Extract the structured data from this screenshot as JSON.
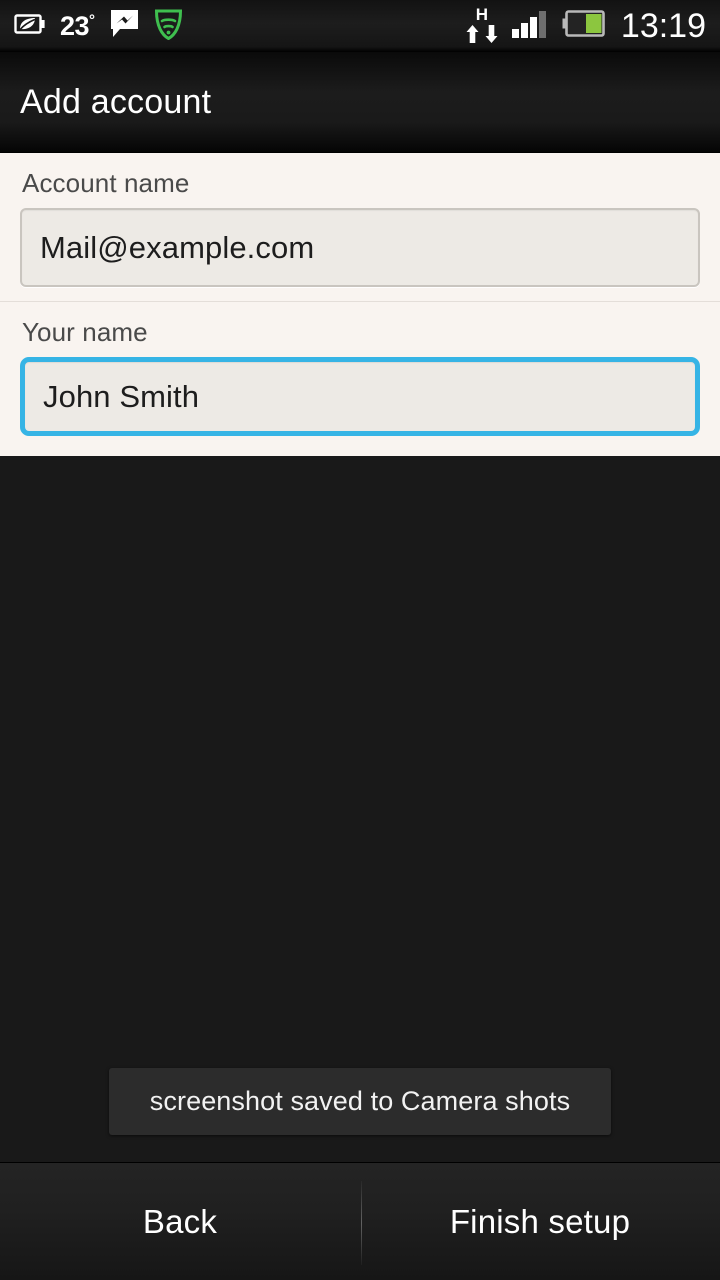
{
  "status_bar": {
    "temperature": "23",
    "temperature_unit": "°",
    "clock": "13:19",
    "network_type": "H",
    "icons": {
      "eco_battery": "eco-battery-icon",
      "messenger": "messenger-icon",
      "security_shield": "security-shield-icon",
      "data_arrows": "data-transfer-arrows-icon",
      "signal": "signal-bars-icon",
      "battery": "battery-icon"
    },
    "signal_bars_filled": 3,
    "signal_bars_total": 4,
    "battery_level_percent": 45,
    "colors": {
      "battery_fill": "#8cc63f",
      "shield": "#3fbf4f"
    }
  },
  "header": {
    "title": "Add account"
  },
  "form": {
    "fields": [
      {
        "label": "Account name",
        "value": "Mail@example.com",
        "focused": false
      },
      {
        "label": "Your name",
        "value": "John Smith",
        "focused": true
      }
    ],
    "focus_color": "#36b4e5"
  },
  "toast": {
    "message": "screenshot saved to Camera shots"
  },
  "bottom_bar": {
    "back_label": "Back",
    "finish_label": "Finish setup"
  }
}
